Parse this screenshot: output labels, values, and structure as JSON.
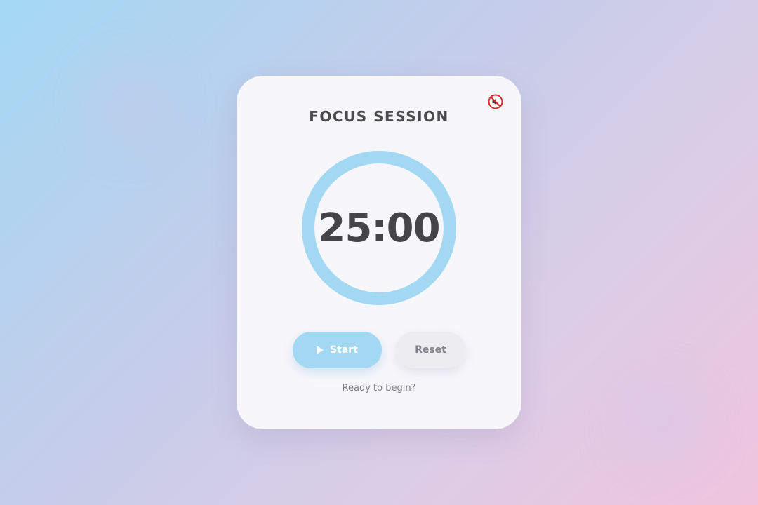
{
  "header": {
    "title": "FOCUS SESSION"
  },
  "sound_toggle": {
    "icon": "muted-speaker-icon",
    "state": "muted"
  },
  "timer": {
    "display": "25:00",
    "progress": 1.0,
    "ring_color": "#a3d8f2"
  },
  "controls": {
    "start_label": "Start",
    "start_icon": "play-icon",
    "reset_label": "Reset"
  },
  "status": {
    "text": "Ready to begin?"
  },
  "colors": {
    "accent": "#a3d8f2",
    "card_bg": "#f7f6fb",
    "text_dark": "#454548",
    "text_muted": "#7d7d85",
    "mute_red": "#d2302c"
  }
}
